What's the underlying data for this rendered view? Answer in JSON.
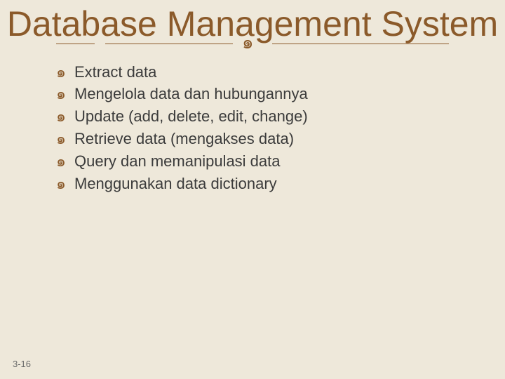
{
  "title": "Database Management System",
  "bullet_glyph": "་",
  "items": [
    "Extract data",
    "Mengelola data dan hubungannya",
    "Update (add, delete, edit, change)",
    "Retrieve data (mengakses data)",
    "Query dan memanipulasi data",
    "Menggunakan data dictionary"
  ],
  "page_number": "3-16"
}
